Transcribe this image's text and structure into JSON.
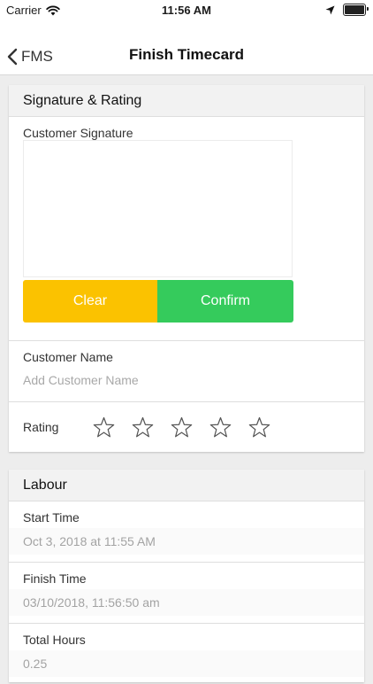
{
  "status_bar": {
    "carrier": "Carrier",
    "time": "11:56 AM",
    "icons": [
      "wifi-icon",
      "location-arrow-icon",
      "battery-icon"
    ]
  },
  "nav": {
    "back_label": "FMS",
    "title": "Finish Timecard"
  },
  "signature_section": {
    "header": "Signature & Rating",
    "signature_label": "Customer Signature",
    "clear_label": "Clear",
    "confirm_label": "Confirm",
    "customer_name_label": "Customer Name",
    "customer_name_value": "",
    "customer_name_placeholder": "Add Customer Name",
    "rating_label": "Rating",
    "rating_value": 0,
    "rating_max": 5
  },
  "labour_section": {
    "header": "Labour",
    "start_time_label": "Start Time",
    "start_time_value": "Oct 3, 2018 at 11:55 AM",
    "finish_time_label": "Finish Time",
    "finish_time_value": "03/10/2018, 11:56:50 am",
    "total_hours_label": "Total Hours",
    "total_hours_value": "0.25"
  },
  "colors": {
    "clear_button": "#fbc200",
    "confirm_button": "#35cb5c",
    "background": "#ededed",
    "header_background": "#f2f2f2"
  }
}
